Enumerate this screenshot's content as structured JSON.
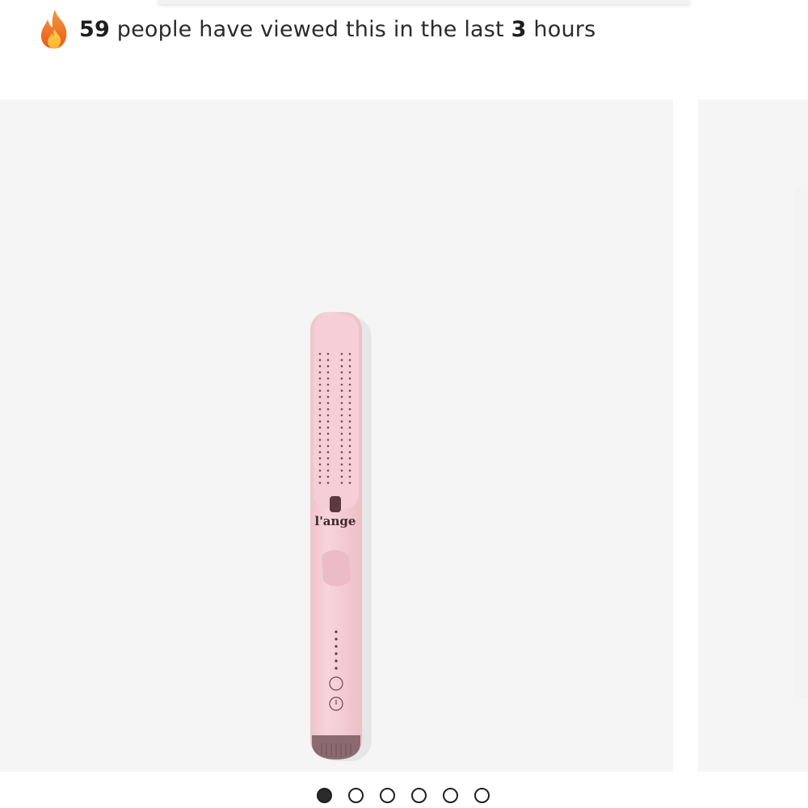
{
  "banner": {
    "view_count": "59",
    "text_middle": " people have viewed this in the last ",
    "hours": "3",
    "text_end": " hours",
    "icon": "fire-icon"
  },
  "gallery": {
    "product_brand_logo": "l'ange",
    "slide_count": 6,
    "active_slide": 1
  },
  "colors": {
    "product_pink": "#f4cdd4",
    "background": "#f5f5f5"
  }
}
